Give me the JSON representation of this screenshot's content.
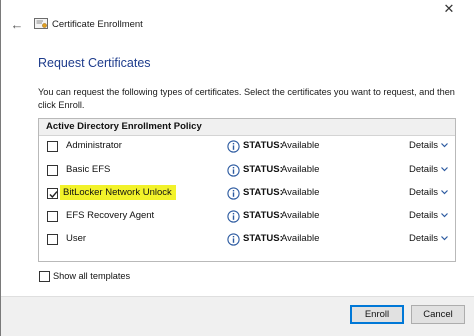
{
  "window": {
    "title": "Certificate Enrollment",
    "close_glyph": "✕",
    "back_glyph": "←"
  },
  "page": {
    "heading": "Request Certificates",
    "description": "You can request the following types of certificates. Select the certificates you want to request, and then click Enroll."
  },
  "policy": {
    "group_label": "Active Directory Enrollment Policy",
    "status_key": "STATUS:",
    "details_label": "Details",
    "rows": [
      {
        "label": "Administrator",
        "checked": false,
        "highlighted": false,
        "status": "Available"
      },
      {
        "label": "Basic EFS",
        "checked": false,
        "highlighted": false,
        "status": "Available"
      },
      {
        "label": "BitLocker Network Unlock",
        "checked": true,
        "highlighted": true,
        "status": "Available"
      },
      {
        "label": "EFS Recovery Agent",
        "checked": false,
        "highlighted": false,
        "status": "Available"
      },
      {
        "label": "User",
        "checked": false,
        "highlighted": false,
        "status": "Available"
      }
    ]
  },
  "show_all": {
    "label": "Show all templates",
    "checked": false
  },
  "buttons": {
    "enroll": "Enroll",
    "cancel": "Cancel"
  },
  "colors": {
    "heading": "#1e3c8c",
    "highlight": "#f2f22a",
    "focus": "#0078d7"
  },
  "icons": {
    "back": "back-arrow-icon",
    "certificate": "certificate-icon",
    "close": "close-icon",
    "info": "info-icon",
    "chevron": "chevron-down-icon"
  }
}
